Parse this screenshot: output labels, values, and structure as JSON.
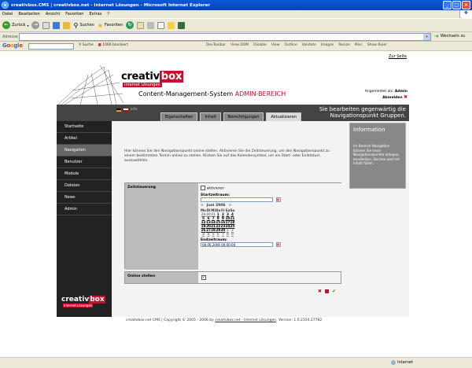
{
  "window": {
    "title": "creativbox.CMS | creativbox.net - Internet Lösungen - Microsoft Internet Explorer"
  },
  "menu": [
    "Datei",
    "Bearbeiten",
    "Ansicht",
    "Favoriten",
    "Extras",
    "?"
  ],
  "toolbar": {
    "back": "Zurück",
    "search": "Suchen",
    "favorites": "Favoriten"
  },
  "address": {
    "label": "Adresse",
    "value": "",
    "go": "Wechseln zu"
  },
  "google": {
    "logo": "Google",
    "search": "Suche",
    "blocked": "1066 blockiert"
  },
  "devtoolbar": [
    "DevToolbar",
    "View DOM",
    "Disable",
    "View",
    "Outline",
    "Validate",
    "Images",
    "Resize",
    "Misc",
    "Show Ruler"
  ],
  "page": {
    "back_link": "Zur Seite",
    "logo": {
      "part1": "creativ",
      "part2": "box",
      "sub": "Internet Lösungen"
    },
    "cms_title": "Content-Management-System",
    "cms_title_accent": "ADMIN-BEREICH",
    "login": {
      "label": "Angemeldet als:",
      "user": "Admin",
      "logout": "Abmelden"
    },
    "lang": "info",
    "tabs": [
      "Eigenschaften",
      "Inhalt",
      "Berechtigungen",
      "Aktualisieren"
    ],
    "active_tab": "Aktualisieren",
    "bar_message": "Sie bearbeiten gegenwärtig die Navigationspunkt Gruppen.",
    "nav": [
      "Startseite",
      "Artikel",
      "Navigation",
      "Benutzer",
      "Module",
      "Dateien",
      "News",
      "Admin"
    ],
    "active_nav": "Navigation",
    "intro": "Hier können Sie den Navigationspunkt online stellen. Aktivieren Sie die Zeitsteuerung, um den Navigationspunkt zu einem bestimmten Termin online zu stellen. Klicken Sie auf das Kalendersymbol, um ein Start- oder Enddatum auszuwählen.",
    "zeit": {
      "label": "Zeitsteuerung",
      "activate": "aktivieren",
      "start_label": "Startzeitraum:",
      "start_value": "",
      "end_label": "Endzeitraum:",
      "end_value": "08.06.2006 00:00:00"
    },
    "calendar": {
      "prev": "<",
      "next": ">",
      "month": "Juni 2006",
      "days": [
        "Mo",
        "Di",
        "Mi",
        "Do",
        "Fr",
        "Sa",
        "So"
      ],
      "weeks": [
        [
          "29",
          "30",
          "31",
          "1",
          "2",
          "3",
          "4"
        ],
        [
          "5",
          "6",
          "7",
          "8",
          "9",
          "10",
          "11"
        ],
        [
          "12",
          "13",
          "14",
          "15",
          "16",
          "17",
          "18"
        ],
        [
          "19",
          "20",
          "21",
          "22",
          "23",
          "24",
          "25"
        ],
        [
          "26",
          "27",
          "28",
          "29",
          "30",
          "1",
          "2"
        ],
        [
          "3",
          "4",
          "5",
          "6",
          "7",
          "8",
          "9"
        ]
      ]
    },
    "online": {
      "label": "Online stellen"
    },
    "info": {
      "title": "Information",
      "text": "Im Bereich Navigation können Sie neue Navigationspunkte anlegen, bearbeiten, löschen und mit Inhalt füllen."
    },
    "footer": {
      "text": "creativbox.net CMS | Copyright © 2005 - 2006 by",
      "link": "creativbox.net - Internet Lösungen",
      "version": ". Version: 1.0.2354.27782"
    },
    "side_logo": {
      "part1": "creativ",
      "part2": "box",
      "sub": "Internet Lösungen"
    }
  },
  "status": {
    "zone": "Internet"
  }
}
